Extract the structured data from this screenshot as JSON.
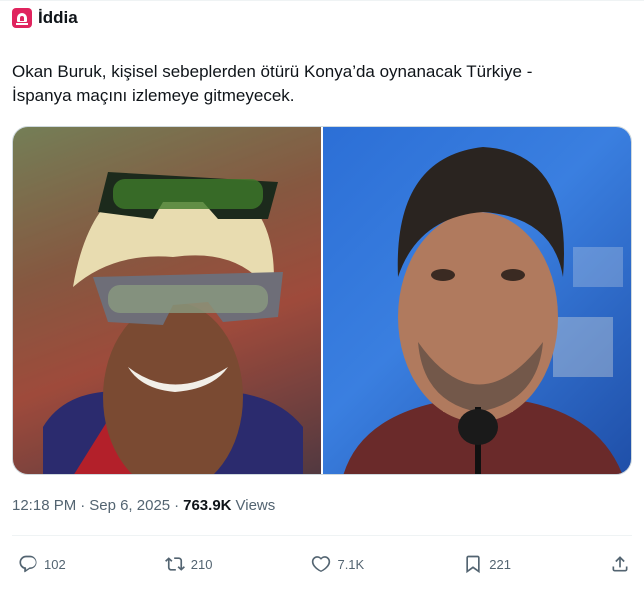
{
  "header": {
    "author": "İddia",
    "icon": "siren-icon",
    "icon_color": "#e0245e"
  },
  "post": {
    "line1": "Okan Buruk, kişisel sebeplerden ötürü Konya’da oynanacak Türkiye -",
    "line2": "İspanya maçını izlemeye gitmeyecek."
  },
  "media": {
    "count": 2
  },
  "meta": {
    "time": "12:18 PM",
    "separator1": "·",
    "date": "Sep 6, 2025",
    "separator2": "·",
    "views_count": "763.9K",
    "views_label": "Views"
  },
  "actions": {
    "replies": "102",
    "reposts": "210",
    "likes": "7.1K",
    "bookmarks": "221"
  },
  "colors": {
    "text": "#0f1419",
    "secondary": "#536471",
    "border": "#cfd9de"
  }
}
